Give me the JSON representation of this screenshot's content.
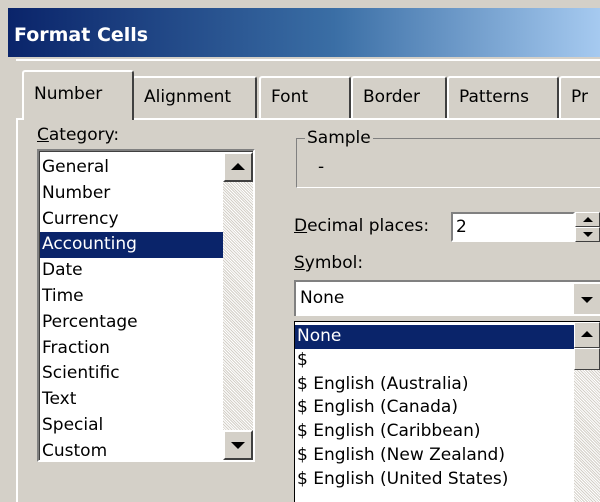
{
  "window": {
    "title": "Format Cells"
  },
  "tabs": [
    {
      "label": "Number",
      "active": true
    },
    {
      "label": "Alignment"
    },
    {
      "label": "Font"
    },
    {
      "label": "Border"
    },
    {
      "label": "Patterns"
    },
    {
      "label": "Pr"
    }
  ],
  "category": {
    "label_accel": "C",
    "label_rest": "ategory:",
    "items": [
      "General",
      "Number",
      "Currency",
      "Accounting",
      "Date",
      "Time",
      "Percentage",
      "Fraction",
      "Scientific",
      "Text",
      "Special",
      "Custom"
    ],
    "selected": "Accounting"
  },
  "sample": {
    "legend": "Sample",
    "value": "-"
  },
  "decimal": {
    "label_accel": "D",
    "label_rest": "ecimal places:",
    "value": "2"
  },
  "symbol": {
    "label_accel": "S",
    "label_rest": "ymbol:",
    "value": "None",
    "options": [
      "None",
      "$",
      "$ English (Australia)",
      "$ English (Canada)",
      "$ English (Caribbean)",
      "$ English (New Zealand)",
      "$ English (United States)"
    ],
    "selected": "None"
  },
  "colors": {
    "titlebar": "#0a246a",
    "selection": "#0a246a",
    "face": "#d4d0c8"
  }
}
